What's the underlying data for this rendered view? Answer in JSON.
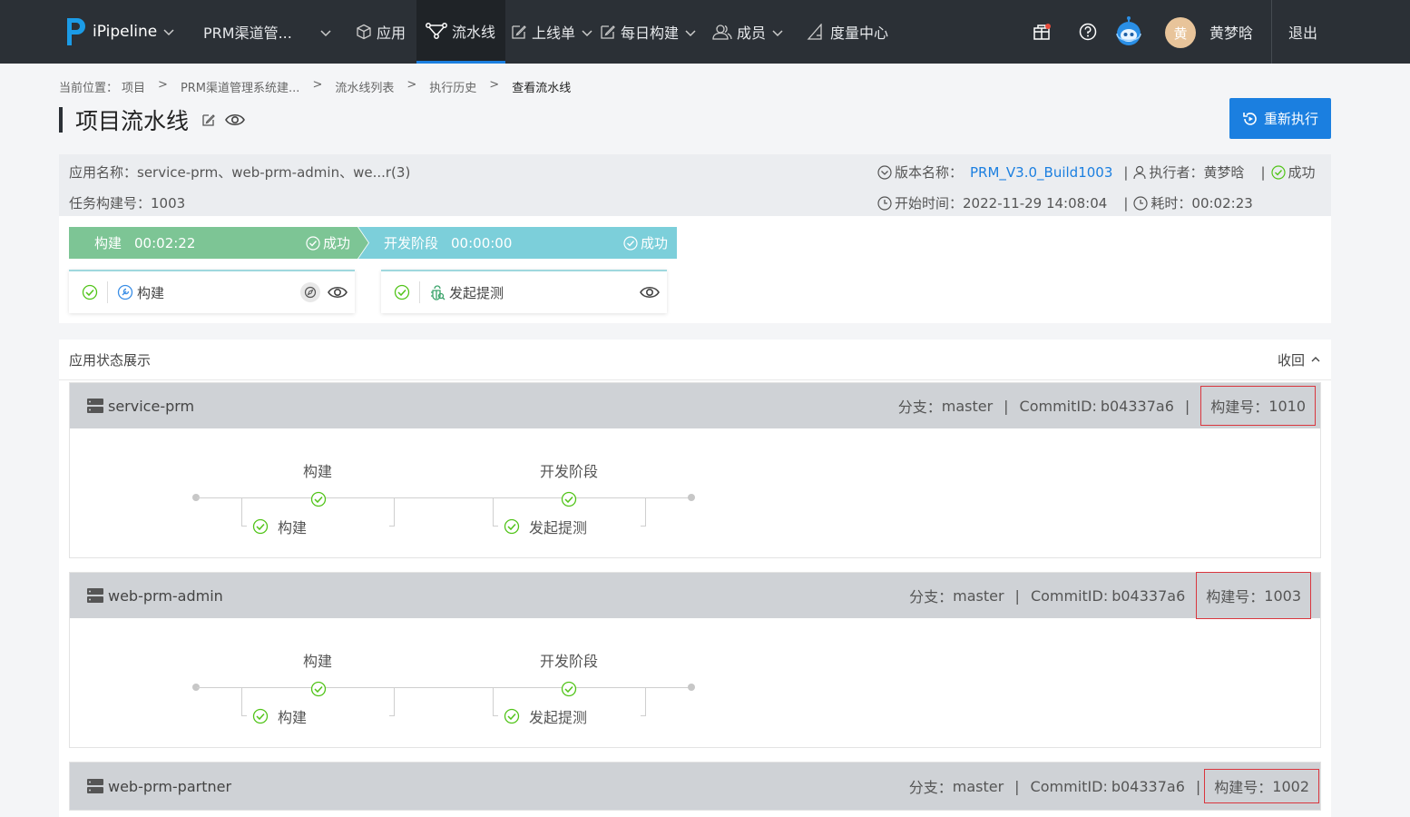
{
  "nav": {
    "brand": "iPipeline",
    "project": "PRM渠道管...",
    "items": {
      "app": "应用",
      "pipeline": "流水线",
      "release": "上线单",
      "daily": "每日构建",
      "members": "成员",
      "metrics": "度量中心"
    },
    "user_initial": "黄",
    "user_name": "黄梦晗",
    "logout": "退出"
  },
  "breadcrumb": {
    "prefix": "当前位置：",
    "items": [
      "项目",
      "PRM渠道管理系统建...",
      "流水线列表",
      "执行历史",
      "查看流水线"
    ],
    "sep": ">"
  },
  "page": {
    "title": "项目流水线",
    "rerun_label": "重新执行"
  },
  "info": {
    "app_name_label": "应用名称：",
    "app_name_value": "service-prm、web-prm-admin、we...r(3)",
    "task_no_label": "任务构建号：",
    "task_no_value": "1003",
    "version_label": "版本名称：",
    "version_value": "PRM_V3.0_Build1003",
    "executor_label": "执行者：",
    "executor_value": "黄梦晗",
    "status": "成功",
    "start_label": "开始时间：",
    "start_value": "2022-11-29 14:08:04",
    "duration_label": "耗时：",
    "duration_value": "00:02:23",
    "pipe": "|"
  },
  "stages": [
    {
      "name": "构建",
      "time": "00:02:22",
      "status": "成功",
      "task": "构建"
    },
    {
      "name": "开发阶段",
      "time": "00:00:00",
      "status": "成功",
      "task": "发起提测"
    }
  ],
  "status_section": {
    "title": "应用状态展示",
    "collapse": "收回"
  },
  "apps": [
    {
      "name": "service-prm",
      "branch_label": "分支：",
      "branch": "master",
      "commit_label": "CommitID: ",
      "commit": "b04337a6",
      "build_label": "构建号：",
      "build": "1010",
      "stage1": "构建",
      "stage2": "开发阶段",
      "task1": "构建",
      "task2": "发起提测"
    },
    {
      "name": "web-prm-admin",
      "branch_label": "分支：",
      "branch": "master",
      "commit_label": "CommitID: ",
      "commit": "b04337a6",
      "build_label": "构建号：",
      "build": "1003",
      "stage1": "构建",
      "stage2": "开发阶段",
      "task1": "构建",
      "task2": "发起提测"
    },
    {
      "name": "web-prm-partner",
      "branch_label": "分支：",
      "branch": "master",
      "commit_label": "CommitID: ",
      "commit": "b04337a6",
      "build_label": "构建号：",
      "build": "1002"
    }
  ],
  "colors": {
    "topbar": "#2b3036",
    "accent": "#1b7fe0",
    "success_green": "#7dc595",
    "stage_teal": "#7ccfda",
    "highlight_red": "#d9363e"
  }
}
